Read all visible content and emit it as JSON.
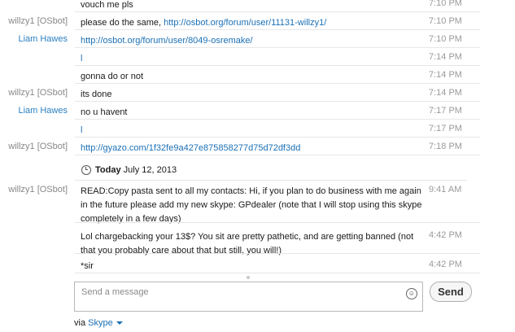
{
  "conversation": {
    "messages_before": [
      {
        "sender": "",
        "sender_kind": "other",
        "text": "vouch me pls",
        "time": "7:10 PM"
      },
      {
        "sender": "willzy1 [OSbot]",
        "sender_kind": "other",
        "text": "please do the same, ",
        "link": "http://osbot.org/forum/user/11131-willzy1/",
        "time": "7:10 PM"
      },
      {
        "sender": "Liam Hawes",
        "sender_kind": "self",
        "text": "",
        "link": "http://osbot.org/forum/user/8049-osremake/",
        "time": "7:10 PM"
      },
      {
        "sender": "",
        "sender_kind": "self",
        "text": "",
        "link": "l",
        "time": "7:14 PM"
      },
      {
        "sender": "",
        "sender_kind": "other",
        "text": "gonna do or not",
        "time": "7:14 PM"
      },
      {
        "sender": "willzy1 [OSbot]",
        "sender_kind": "other",
        "text": "its done",
        "time": "7:14 PM"
      },
      {
        "sender": "Liam Hawes",
        "sender_kind": "self",
        "text": "no u havent",
        "time": "7:17 PM"
      },
      {
        "sender": "",
        "sender_kind": "self",
        "text": "",
        "link": "l",
        "time": "7:17 PM"
      },
      {
        "sender": "willzy1 [OSbot]",
        "sender_kind": "other",
        "text": "",
        "link": "http://gyazo.com/1f32fe9a427e875858277d75d72df3dd",
        "time": "7:18 PM"
      }
    ],
    "day_separator": {
      "label": "Today",
      "date": "July 12, 2013"
    },
    "messages_after": [
      {
        "sender": "willzy1 [OSbot]",
        "sender_kind": "other",
        "text": "READ:Copy pasta sent to all my contacts: Hi, if you plan to do business with me again in the future please add my new skype: GPdealer (note that I will stop using this skype completely in a few days)",
        "time": "9:41 AM"
      },
      {
        "sender": "",
        "sender_kind": "other",
        "text": "Lol chargebacking your 13$? You sit are pretty pathetic, and are getting banned (not that you probably care about that but still, you will!)",
        "time": "4:42 PM"
      },
      {
        "sender": "",
        "sender_kind": "other",
        "text": "*sir",
        "time": "4:42 PM"
      }
    ]
  },
  "composer": {
    "placeholder": "Send a message",
    "send_label": "Send",
    "emoticon_icon": "smiley-icon"
  },
  "footer": {
    "via_label": "via",
    "brand": "Skype"
  },
  "colors": {
    "self_name": "#2b7fc1",
    "other_name": "#888888",
    "link": "#1c70b5",
    "time": "#9a9a9a"
  }
}
